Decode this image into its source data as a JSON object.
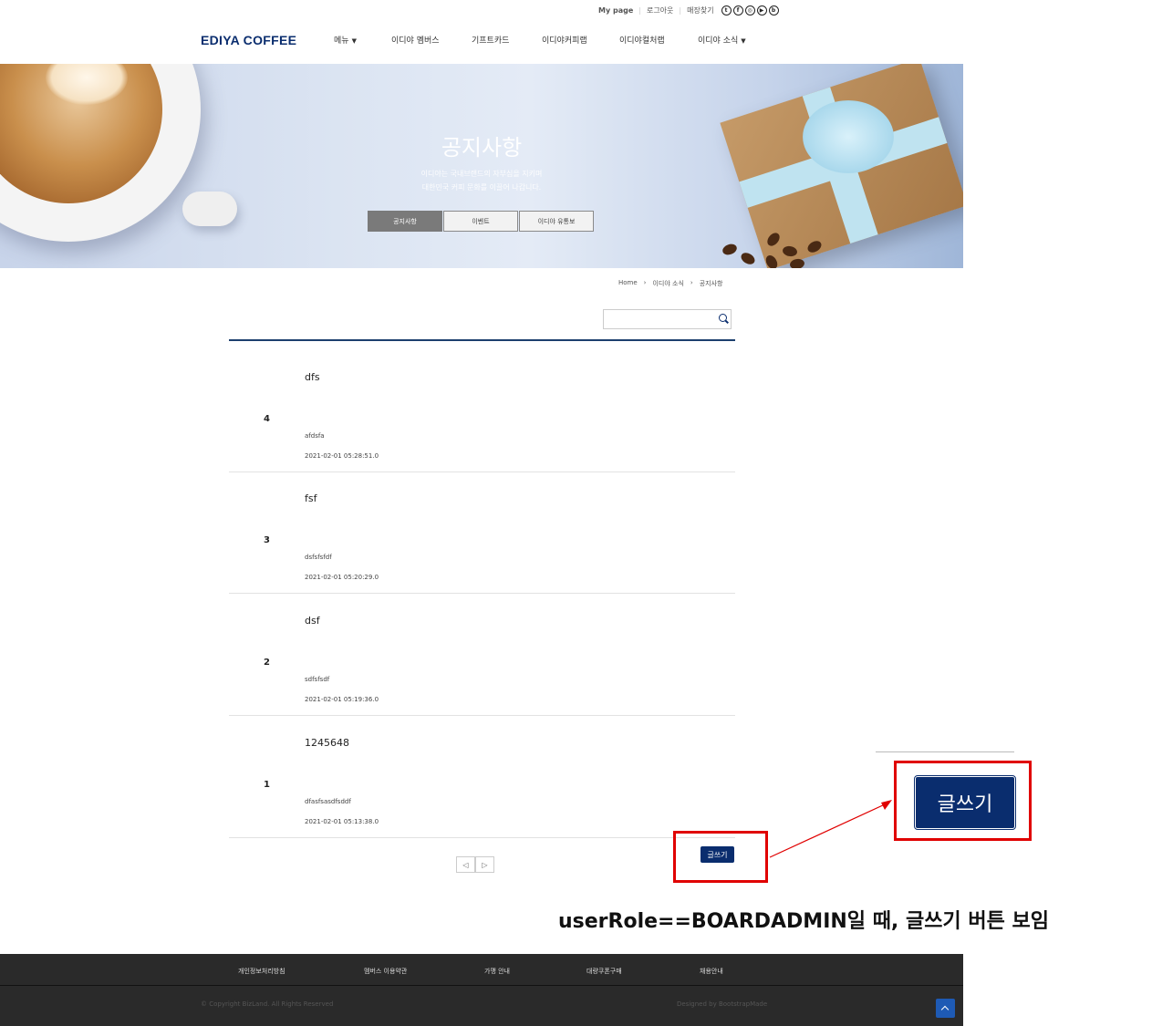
{
  "util": {
    "mypage": "My page",
    "logout": "로그아웃",
    "store": "매장찾기",
    "social": [
      "twitter-icon",
      "facebook-icon",
      "instagram-icon",
      "youtube-icon",
      "blog-icon"
    ]
  },
  "logo": "EDIYA COFFEE",
  "nav": [
    "메뉴",
    "이디야 멤버스",
    "기프트카드",
    "이디야커피랩",
    "이디야컬처랩",
    "이디야 소식"
  ],
  "hero": {
    "title": "공지사항",
    "sub1": "이디야는 국내브랜드의 자부심을 지키며",
    "sub2": "대한민국 커피 문화를 이끌어 나갑니다.",
    "tabs": [
      "공지사항",
      "이벤트",
      "이디야 유통보"
    ]
  },
  "breadcrumb": [
    "Home",
    "이디야 소식",
    "공지사항"
  ],
  "search": {
    "placeholder": ""
  },
  "posts": [
    {
      "num": "4",
      "title": "dfs",
      "body": "afdsfa",
      "date": "2021-02-01 05:28:51.0"
    },
    {
      "num": "3",
      "title": "fsf",
      "body": "dsfsfsfdf",
      "date": "2021-02-01 05:20:29.0"
    },
    {
      "num": "2",
      "title": "dsf",
      "body": "sdfsfsdf",
      "date": "2021-02-01 05:19:36.0"
    },
    {
      "num": "1",
      "title": "1245648",
      "body": "dfasfsasdfsddf",
      "date": "2021-02-01 05:13:38.0"
    }
  ],
  "pager": {
    "prev": "◁",
    "next": "▷"
  },
  "write_button": "글쓰기",
  "caption": "userRole==BOARDADMIN일 때, 글쓰기 버튼 보임",
  "footer": {
    "links": [
      "개인정보처리방침",
      "멤버스 이용약관",
      "가맹 안내",
      "대량쿠폰구매",
      "채용안내"
    ],
    "copyright": "© Copyright BizLand. All Rights Reserved",
    "designed": "Designed by BootstrapMade"
  },
  "colors": {
    "brand": "#0a2d6e",
    "highlight": "#e00000",
    "footer": "#2a2a2a",
    "totop": "#1e5ab4"
  }
}
